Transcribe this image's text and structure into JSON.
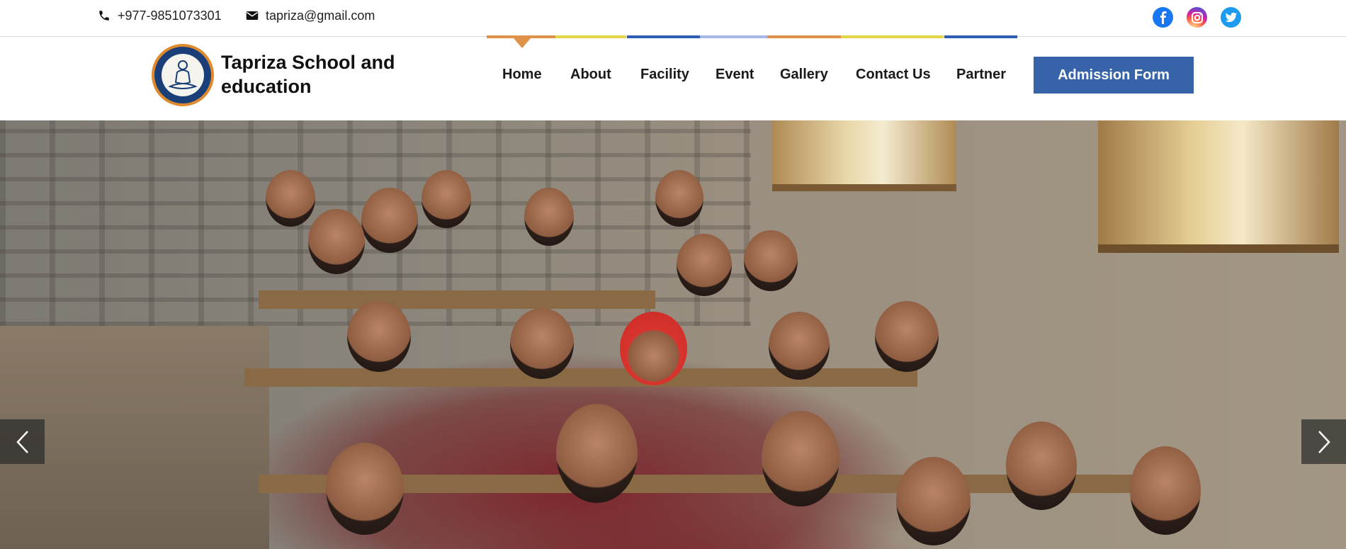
{
  "topbar": {
    "phone": "+977-9851073301",
    "email": "tapriza@gmail.com",
    "social": [
      {
        "name": "facebook-icon",
        "color": "#1877f2"
      },
      {
        "name": "instagram-icon",
        "color": "#d6249f"
      },
      {
        "name": "twitter-icon",
        "color": "#1d9bf0"
      }
    ]
  },
  "header": {
    "brand_name": "Tapriza School and education",
    "nav": [
      "Home",
      "About",
      "Facility",
      "Event",
      "Gallery",
      "Contact Us",
      "Partner"
    ],
    "active_nav": "Home",
    "admission_label": "Admission Form",
    "accent_colors": [
      "#e0924a",
      "#e3d54a",
      "#2f5fb3",
      "#a7b8e8"
    ]
  },
  "hero": {
    "slider_icons": [
      "chevron-left-icon",
      "chevron-right-icon"
    ]
  }
}
